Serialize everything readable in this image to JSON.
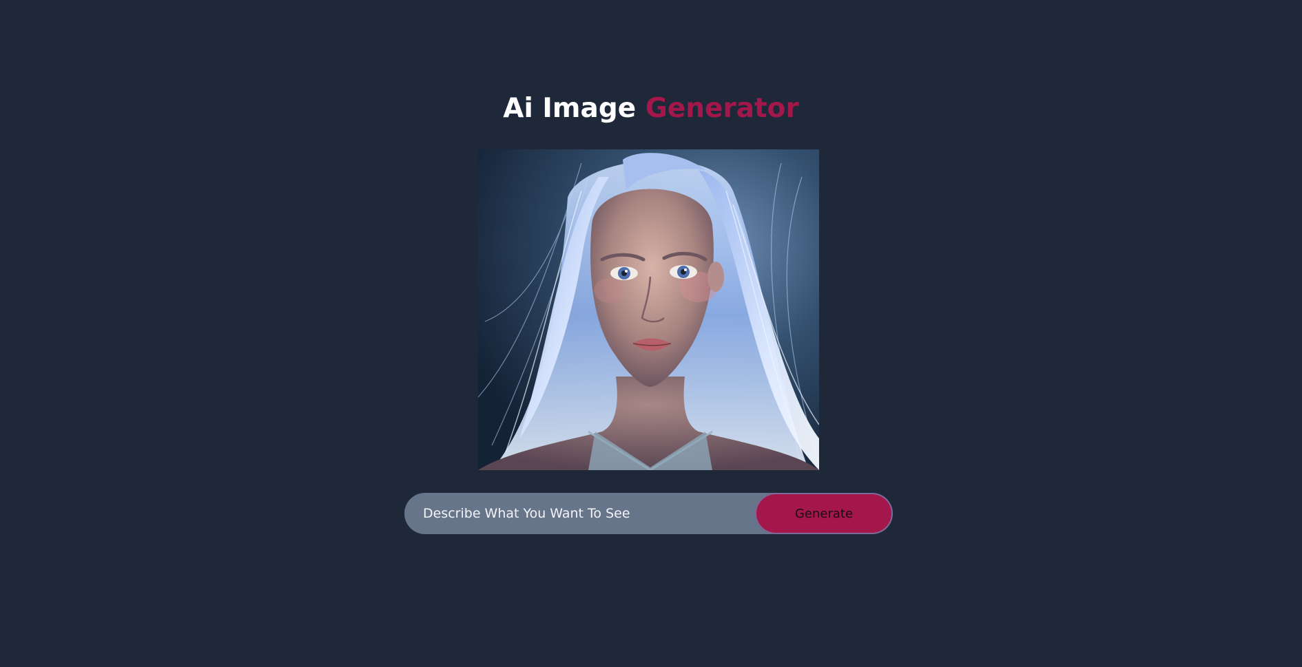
{
  "header": {
    "title_main": "Ai Image",
    "title_accent": "Generator"
  },
  "preview": {
    "image_subject": "ai-generated portrait of a young woman with glowing light-blue hair"
  },
  "prompt": {
    "placeholder": "Describe What You Want To See",
    "value": ""
  },
  "actions": {
    "generate_label": "Generate"
  },
  "colors": {
    "background": "#1f2839",
    "accent": "#a3174b",
    "input_bg": "#67758b",
    "title_text": "#ffffff"
  }
}
